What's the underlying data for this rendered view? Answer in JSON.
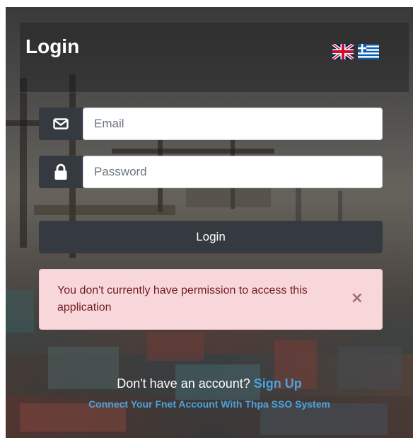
{
  "header": {
    "title": "Login",
    "languages": [
      {
        "name": "English",
        "icon": "uk-flag-icon"
      },
      {
        "name": "Greek",
        "icon": "greece-flag-icon"
      }
    ]
  },
  "form": {
    "email": {
      "placeholder": "Email",
      "value": "",
      "icon": "envelope-icon"
    },
    "password": {
      "placeholder": "Password",
      "value": "",
      "icon": "lock-icon"
    },
    "login_label": "Login"
  },
  "alert": {
    "message": "You don't currently have permission to access this application",
    "close_icon": "×"
  },
  "footer": {
    "signup_prompt": "Don't have an account?",
    "signup_label": "Sign Up",
    "sso_label": "Connect Your Fnet Account With Thpa SSO System"
  },
  "colors": {
    "dark": "#343a40",
    "alert_bg": "#f8d7da",
    "alert_text": "#721c24",
    "link": "#4aa3df"
  }
}
